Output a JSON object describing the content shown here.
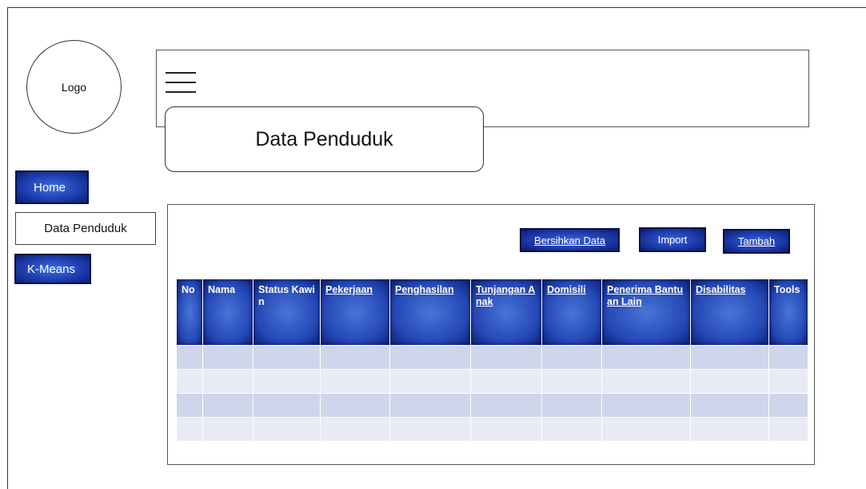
{
  "logo": {
    "label": "Logo"
  },
  "page_title": "Data Penduduk",
  "sidebar": {
    "items": [
      {
        "label": "Home"
      },
      {
        "label": "Data Penduduk"
      },
      {
        "label": "K-Means"
      }
    ]
  },
  "actions": {
    "clear_label": "Bersihkan Data",
    "import_label": "Import",
    "add_label": "Tambah"
  },
  "table": {
    "headers": [
      "No",
      "Nama",
      "Status Kawin",
      "Pekerjaan",
      "Penghasilan",
      "Tunjangan Anak",
      "Domisili",
      "Penerima Bantuan Lain",
      "Disabilitas",
      "Tools"
    ],
    "rows": [
      [
        "",
        "",
        "",
        "",
        "",
        "",
        "",
        "",
        "",
        ""
      ],
      [
        "",
        "",
        "",
        "",
        "",
        "",
        "",
        "",
        "",
        ""
      ],
      [
        "",
        "",
        "",
        "",
        "",
        "",
        "",
        "",
        "",
        ""
      ],
      [
        "",
        "",
        "",
        "",
        "",
        "",
        "",
        "",
        "",
        ""
      ]
    ]
  },
  "colors": {
    "accent": "#1f3fb2",
    "row_dark": "#cfd5ea",
    "row_light": "#e9ebf4"
  },
  "icons": {
    "menu": "hamburger-menu-icon"
  }
}
